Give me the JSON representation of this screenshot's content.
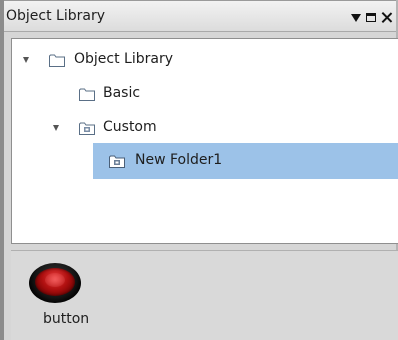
{
  "panel": {
    "title": "Object Library"
  },
  "tree": {
    "root": {
      "label": "Object Library",
      "expanded": true
    },
    "children": [
      {
        "label": "Basic",
        "icon": "folder-icon"
      },
      {
        "label": "Custom",
        "icon": "custom-folder-icon",
        "expanded": true,
        "children": [
          {
            "label": "New Folder1",
            "icon": "custom-folder-icon",
            "selected": true
          }
        ]
      }
    ]
  },
  "library": {
    "items": [
      {
        "label": "button",
        "icon": "red-round-button-icon"
      }
    ]
  },
  "colors": {
    "selection": "#9cc2e8",
    "panel_bg": "#d6d6d6",
    "button_red": "#c01818"
  }
}
